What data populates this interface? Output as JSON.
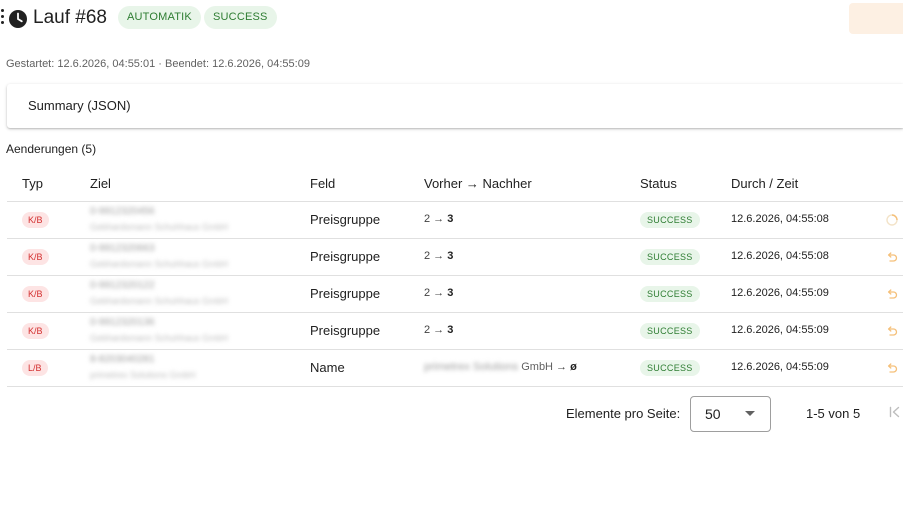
{
  "header": {
    "title": "Lauf #68",
    "mode_chip": "AUTOMATIK",
    "status_chip": "SUCCESS",
    "icons": {
      "drag": "drag-handle-icon",
      "history": "history-icon"
    }
  },
  "times": "Gestartet: 12.6.2026, 04:55:01 · Beendet: 12.6.2026, 04:55:09",
  "summary": {
    "title": "Summary (JSON)"
  },
  "changes": {
    "title": "Aenderungen (5)",
    "columns": [
      "Typ",
      "Ziel",
      "Feld",
      "Vorher → Nachher",
      "Status",
      "Durch / Zeit"
    ],
    "rows": [
      {
        "type": "K/B",
        "target_id": "0-9912320456",
        "target_name": "Gebhardsmann Schuhhaus GmbH",
        "field": "Preisgruppe",
        "before": "2",
        "after": "3",
        "status": "SUCCESS",
        "time": "12.6.2026, 04:55:08",
        "action_icon": "spinner-icon"
      },
      {
        "type": "K/B",
        "target_id": "0-9912320663",
        "target_name": "Gebhardsmann Schuhhaus GmbH",
        "field": "Preisgruppe",
        "before": "2",
        "after": "3",
        "status": "SUCCESS",
        "time": "12.6.2026, 04:55:08",
        "action_icon": "undo-icon"
      },
      {
        "type": "K/B",
        "target_id": "0-9912320122",
        "target_name": "Gebhardsmann Schuhhaus GmbH",
        "field": "Preisgruppe",
        "before": "2",
        "after": "3",
        "status": "SUCCESS",
        "time": "12.6.2026, 04:55:09",
        "action_icon": "undo-icon"
      },
      {
        "type": "K/B",
        "target_id": "0-9912320136",
        "target_name": "Gebhardsmann Schuhhaus GmbH",
        "field": "Preisgruppe",
        "before": "2",
        "after": "3",
        "status": "SUCCESS",
        "time": "12.6.2026, 04:55:09",
        "action_icon": "undo-icon"
      },
      {
        "type": "L/B",
        "target_id": "8-8203040281",
        "target_name": "primetrex Solutions GmbH",
        "field": "Name",
        "before_blurred": "primetrex Solutions",
        "before": "GmbH",
        "after": "ø",
        "status": "SUCCESS",
        "time": "12.6.2026, 04:55:09",
        "action_icon": "undo-icon"
      }
    ]
  },
  "pagination": {
    "label": "Elemente pro Seite:",
    "page_size": "50",
    "range": "1-5 von 5",
    "first_icon": "first-page-icon"
  },
  "colors": {
    "success_bg": "#e8f5e9",
    "success_fg": "#2e7d32",
    "type_bg": "#fde4e4",
    "type_fg": "#d32f2f",
    "action_accent": "#f5c07a",
    "header_action_bg": "#fdf0e3"
  }
}
